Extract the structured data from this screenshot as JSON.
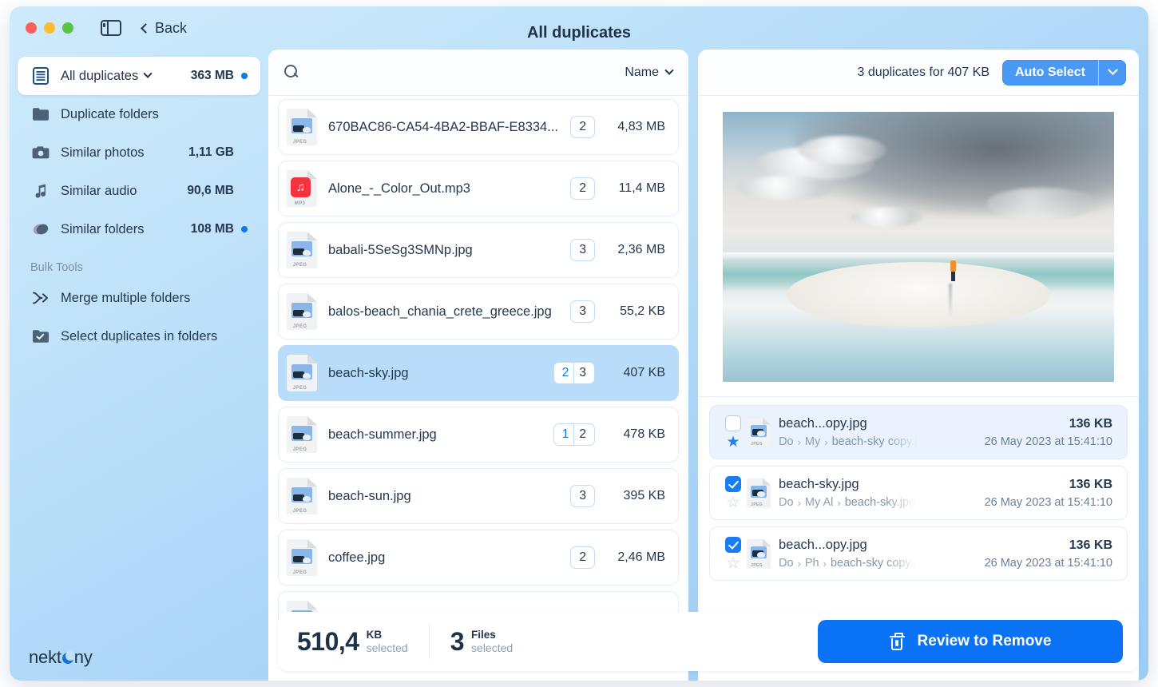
{
  "window": {
    "title": "All duplicates",
    "back_label": "Back",
    "traffic_lights": [
      "close-button",
      "minimize-button",
      "zoom-button"
    ],
    "sidebar_toggle_icon": "sidebar-toggle-icon"
  },
  "sidebar": {
    "items": [
      {
        "icon": "list-document-icon",
        "label": "All duplicates",
        "size": "363 MB",
        "has_caret": true,
        "badge": true,
        "active": true
      },
      {
        "icon": "folder-icon",
        "label": "Duplicate folders",
        "size": "",
        "has_caret": false,
        "badge": false,
        "active": false
      },
      {
        "icon": "camera-icon",
        "label": "Similar photos",
        "size": "1,11 GB",
        "has_caret": false,
        "badge": false,
        "active": false
      },
      {
        "icon": "music-note-icon",
        "label": "Similar audio",
        "size": "90,6 MB",
        "has_caret": false,
        "badge": false,
        "active": false
      },
      {
        "icon": "similar-folders-icon",
        "label": "Similar folders",
        "size": "108 MB",
        "has_caret": true,
        "badge": true,
        "active": false
      }
    ],
    "section_title": "Bulk Tools",
    "tools": [
      {
        "icon": "merge-arrow-icon",
        "label": "Merge multiple folders"
      },
      {
        "icon": "checkbox-folder-icon",
        "label": "Select duplicates in folders"
      }
    ]
  },
  "list_panel": {
    "search_placeholder": "",
    "search_value": "",
    "sort_label": "Name",
    "files": [
      {
        "name": "670BAC86-CA54-4BA2-BBAF-E8334...",
        "type": "JPEG",
        "selected_count": "",
        "total_count": "2",
        "size": "4,83 MB",
        "selected": false
      },
      {
        "name": "Alone_-_Color_Out.mp3",
        "type": "MP3",
        "selected_count": "",
        "total_count": "2",
        "size": "11,4 MB",
        "selected": false
      },
      {
        "name": "babali-5SeSg3SMNp.jpg",
        "type": "JPEG",
        "selected_count": "",
        "total_count": "3",
        "size": "2,36 MB",
        "selected": false
      },
      {
        "name": "balos-beach_chania_crete_greece.jpg",
        "type": "JPEG",
        "selected_count": "",
        "total_count": "3",
        "size": "55,2 KB",
        "selected": false
      },
      {
        "name": "beach-sky.jpg",
        "type": "JPEG",
        "selected_count": "2",
        "total_count": "3",
        "size": "407 KB",
        "selected": true
      },
      {
        "name": "beach-summer.jpg",
        "type": "JPEG",
        "selected_count": "1",
        "total_count": "2",
        "size": "478 KB",
        "selected": false
      },
      {
        "name": "beach-sun.jpg",
        "type": "JPEG",
        "selected_count": "",
        "total_count": "3",
        "size": "395 KB",
        "selected": false
      },
      {
        "name": "coffee.jpg",
        "type": "JPEG",
        "selected_count": "",
        "total_count": "2",
        "size": "2,46 MB",
        "selected": false
      }
    ]
  },
  "right_panel": {
    "duplicates_summary": "3 duplicates for 407 KB",
    "auto_select_label": "Auto Select",
    "preview_alt": "beach-sky-preview",
    "duplicates": [
      {
        "name": "beach...opy.jpg",
        "size": "136 KB",
        "path": [
          "Do",
          "My",
          "beach-sky copy.j"
        ],
        "date": "26 May 2023 at 15:41:10",
        "checked": false,
        "starred": true,
        "highlight": true
      },
      {
        "name": "beach-sky.jpg",
        "size": "136 KB",
        "path": [
          "Do",
          "My Al",
          "beach-sky.jpg"
        ],
        "date": "26 May 2023 at 15:41:10",
        "checked": true,
        "starred": false,
        "highlight": false
      },
      {
        "name": "beach...opy.jpg",
        "size": "136 KB",
        "path": [
          "Do",
          "Ph",
          "beach-sky copy.j"
        ],
        "date": "26 May 2023 at 15:41:10",
        "checked": true,
        "starred": false,
        "highlight": false
      }
    ]
  },
  "bottom_bar": {
    "size_number": "510,4",
    "size_unit": "KB",
    "size_caption": "selected",
    "files_number": "3",
    "files_unit": "Files",
    "files_caption": "selected",
    "review_button": "Review to Remove",
    "review_icon": "trash-icon"
  },
  "branding": {
    "logo_pre": "nekt",
    "logo_post": "ny"
  },
  "colors": {
    "accent": "#0a72f5",
    "auto_select": "#4a9af5",
    "badge_dot": "#0a7bf0",
    "selected_row": "#b9dcfb",
    "text": "#24384f",
    "muted": "#8aa0b5"
  }
}
